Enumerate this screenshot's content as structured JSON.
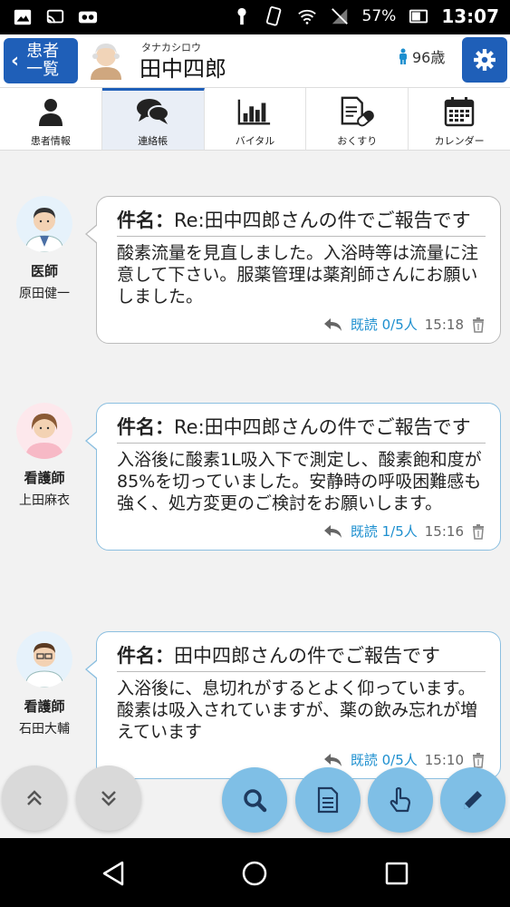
{
  "status_bar": {
    "battery": "57%",
    "time": "13:07"
  },
  "header": {
    "back_label_line1": "患者",
    "back_label_line2": "一覧",
    "patient_kana": "タナカシロウ",
    "patient_name": "田中四郎",
    "patient_age": "96歳"
  },
  "tabs": [
    {
      "label": "患者情報",
      "icon": "person-icon",
      "active": false
    },
    {
      "label": "連絡帳",
      "icon": "chat-icon",
      "active": true
    },
    {
      "label": "バイタル",
      "icon": "bar-chart-icon",
      "active": false
    },
    {
      "label": "おくすり",
      "icon": "medicine-icon",
      "active": false
    },
    {
      "label": "カレンダー",
      "icon": "calendar-icon",
      "active": false
    }
  ],
  "messages": [
    {
      "role": "医師",
      "name": "原田健一",
      "subject_prefix": "件名：",
      "subject": "Re:田中四郎さんの件でご報告です",
      "body": "酸素流量を見直しました。入浴時等は流量に注意して下さい。服薬管理は薬剤師さんにお願いしました。",
      "read_status": "既読 0/5人",
      "time": "15:18"
    },
    {
      "role": "看護師",
      "name": "上田麻衣",
      "subject_prefix": "件名：",
      "subject": "Re:田中四郎さんの件でご報告です",
      "body": "入浴後に酸素1L吸入下で測定し、酸素飽和度が85%を切っていました。安静時の呼吸困難感も強く、処方変更のご検討をお願いします。",
      "read_status": "既読 1/5人",
      "time": "15:16"
    },
    {
      "role": "看護師",
      "name": "石田大輔",
      "subject_prefix": "件名：",
      "subject": "田中四郎さんの件でご報告です",
      "body": "入浴後に、息切れがするとよく仰っています。酸素は吸入されていますが、薬の飲み忘れが増えています",
      "read_status": "既読 0/5人",
      "time": "15:10"
    }
  ],
  "colors": {
    "primary": "#1f5fb8",
    "accent_read": "#1d8fcf",
    "fab_blue": "#7fbfe6",
    "fab_gray": "#d9d9d9"
  }
}
